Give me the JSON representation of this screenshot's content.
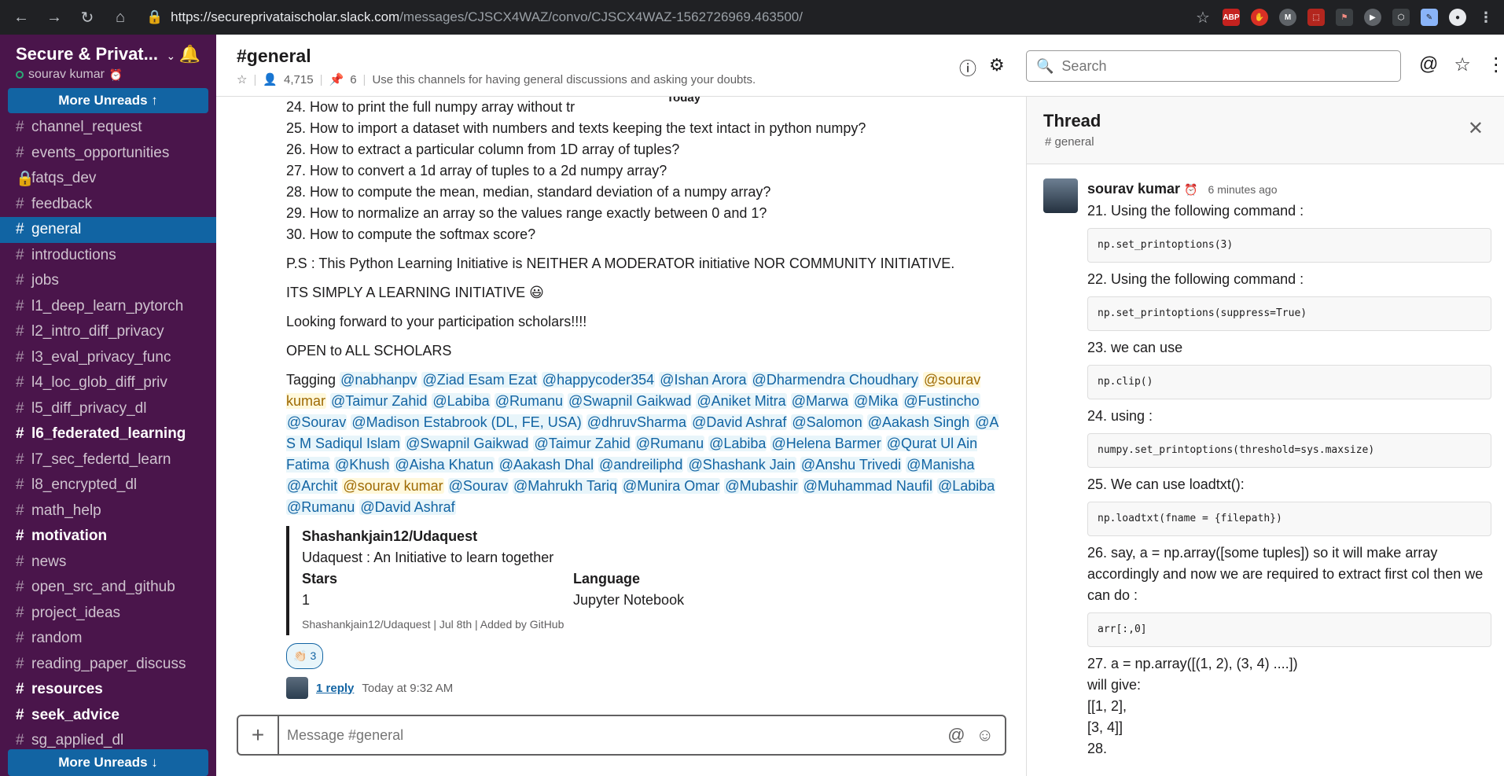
{
  "browser": {
    "url_host": "https://secureprivataischolar.slack.com",
    "url_path": "/messages/CJSCX4WAZ/convo/CJSCX4WAZ-1562726969.463500/",
    "extensions": [
      "ABP",
      "M"
    ]
  },
  "sidebar": {
    "workspace": "Secure & Privat...",
    "user": "sourav kumar",
    "more_unreads_top": "More Unreads ↑",
    "more_unreads_bottom": "More Unreads ↓",
    "channels": [
      {
        "name": "channel_request",
        "state": "normal",
        "icon": "#"
      },
      {
        "name": "events_opportunities",
        "state": "normal",
        "icon": "#"
      },
      {
        "name": "fatqs_dev",
        "state": "normal",
        "icon": "🔒"
      },
      {
        "name": "feedback",
        "state": "normal",
        "icon": "#"
      },
      {
        "name": "general",
        "state": "active",
        "icon": "#"
      },
      {
        "name": "introductions",
        "state": "normal",
        "icon": "#"
      },
      {
        "name": "jobs",
        "state": "normal",
        "icon": "#"
      },
      {
        "name": "l1_deep_learn_pytorch",
        "state": "normal",
        "icon": "#"
      },
      {
        "name": "l2_intro_diff_privacy",
        "state": "normal",
        "icon": "#"
      },
      {
        "name": "l3_eval_privacy_func",
        "state": "normal",
        "icon": "#"
      },
      {
        "name": "l4_loc_glob_diff_priv",
        "state": "normal",
        "icon": "#"
      },
      {
        "name": "l5_diff_privacy_dl",
        "state": "normal",
        "icon": "#"
      },
      {
        "name": "l6_federated_learning",
        "state": "bold",
        "icon": "#"
      },
      {
        "name": "l7_sec_federtd_learn",
        "state": "normal",
        "icon": "#"
      },
      {
        "name": "l8_encrypted_dl",
        "state": "normal",
        "icon": "#"
      },
      {
        "name": "math_help",
        "state": "normal",
        "icon": "#"
      },
      {
        "name": "motivation",
        "state": "bold",
        "icon": "#"
      },
      {
        "name": "news",
        "state": "normal",
        "icon": "#"
      },
      {
        "name": "open_src_and_github",
        "state": "normal",
        "icon": "#"
      },
      {
        "name": "project_ideas",
        "state": "normal",
        "icon": "#"
      },
      {
        "name": "random",
        "state": "normal",
        "icon": "#"
      },
      {
        "name": "reading_paper_discuss",
        "state": "normal",
        "icon": "#"
      },
      {
        "name": "resources",
        "state": "bold",
        "icon": "#"
      },
      {
        "name": "seek_advice",
        "state": "bold",
        "icon": "#"
      },
      {
        "name": "sg_applied_dl",
        "state": "normal",
        "icon": "#"
      }
    ]
  },
  "header": {
    "title": "#general",
    "members": "4,715",
    "pins": "6",
    "topic": "Use this channels for having general discussions and asking your doubts.",
    "search_placeholder": "Search"
  },
  "message": {
    "today_label": "Today",
    "questions": [
      "24. How to print the full numpy array without tr",
      "25. How to import a dataset with numbers and texts keeping the text intact in python numpy?",
      "26. How to extract a particular column from 1D array of tuples?",
      "27. How to convert a 1d array of tuples to a 2d numpy array?",
      "28. How to compute the mean, median, standard deviation of a numpy array?",
      "29. How to normalize an array so the values range exactly between 0 and 1?",
      "30. How to compute the softmax score?"
    ],
    "ps": "P.S : This Python Learning Initiative is NEITHER A MODERATOR initiative NOR COMMUNITY INITIATIVE.",
    "simply": "ITS SIMPLY A LEARNING INITIATIVE 😃",
    "forward": "Looking forward to your participation scholars!!!!",
    "open": "OPEN to ALL SCHOLARS",
    "tagging_label": "Tagging",
    "mentions": [
      {
        "name": "@nabhanpv",
        "self": false
      },
      {
        "name": "@Ziad Esam Ezat",
        "self": false
      },
      {
        "name": "@happycoder354",
        "self": false
      },
      {
        "name": "@Ishan Arora",
        "self": false
      },
      {
        "name": "@Dharmendra Choudhary",
        "self": false
      },
      {
        "name": "@sourav kumar",
        "self": true
      },
      {
        "name": "@Taimur Zahid",
        "self": false
      },
      {
        "name": "@Labiba",
        "self": false
      },
      {
        "name": "@Rumanu",
        "self": false
      },
      {
        "name": "@Swapnil Gaikwad",
        "self": false
      },
      {
        "name": "@Aniket Mitra",
        "self": false
      },
      {
        "name": "@Marwa",
        "self": false
      },
      {
        "name": "@Mika",
        "self": false
      },
      {
        "name": "@Fustincho",
        "self": false
      },
      {
        "name": "@Sourav",
        "self": false
      },
      {
        "name": "@Madison Estabrook (DL, FE, USA)",
        "self": false
      },
      {
        "name": "@dhruvSharma",
        "self": false
      },
      {
        "name": "@David Ashraf",
        "self": false
      },
      {
        "name": "@Salomon",
        "self": false
      },
      {
        "name": "@Aakash Singh",
        "self": false
      },
      {
        "name": "@A S M Sadiqul Islam",
        "self": false
      },
      {
        "name": "@Swapnil Gaikwad",
        "self": false
      },
      {
        "name": "@Taimur Zahid",
        "self": false
      },
      {
        "name": "@Rumanu",
        "self": false
      },
      {
        "name": "@Labiba",
        "self": false
      },
      {
        "name": "@Helena Barmer",
        "self": false
      },
      {
        "name": "@Qurat Ul Ain Fatima",
        "self": false
      },
      {
        "name": "@Khush",
        "self": false
      },
      {
        "name": "@Aisha Khatun",
        "self": false
      },
      {
        "name": "@Aakash Dhal",
        "self": false
      },
      {
        "name": "@andreiliphd",
        "self": false
      },
      {
        "name": "@Shashank Jain",
        "self": false
      },
      {
        "name": "@Anshu Trivedi",
        "self": false
      },
      {
        "name": "@Manisha",
        "self": false
      },
      {
        "name": "@Archit",
        "self": false
      },
      {
        "name": "@sourav kumar",
        "self": true
      },
      {
        "name": "@Sourav",
        "self": false
      },
      {
        "name": "@Mahrukh Tariq",
        "self": false
      },
      {
        "name": "@Munira Omar",
        "self": false
      },
      {
        "name": "@Mubashir",
        "self": false
      },
      {
        "name": "@Muhammad Naufil",
        "self": false
      },
      {
        "name": "@Labiba",
        "self": false
      },
      {
        "name": "@Rumanu",
        "self": false
      },
      {
        "name": "@David Ashraf",
        "self": false
      }
    ],
    "attachment": {
      "title": "Shashankjain12/Udaquest",
      "desc": "Udaquest : An Initiative to learn together",
      "field1_label": "Stars",
      "field1_value": "1",
      "field2_label": "Language",
      "field2_value": "Jupyter Notebook",
      "footer": "Shashankjain12/Udaquest | Jul 8th | Added by GitHub"
    },
    "reaction_emoji": "👏🏻",
    "reaction_count": "3",
    "reply_link": "1 reply",
    "reply_time": "Today at 9:32 AM"
  },
  "composer": {
    "placeholder": "Message #general"
  },
  "thread": {
    "title": "Thread",
    "channel": "# general",
    "author": "sourav kumar",
    "time": "6 minutes ago",
    "blocks": [
      {
        "type": "text",
        "value": "21. Using the following command :"
      },
      {
        "type": "code",
        "value": "np.set_printoptions(3)"
      },
      {
        "type": "text",
        "value": "22. Using the following command :"
      },
      {
        "type": "code",
        "value": "np.set_printoptions(suppress=True)"
      },
      {
        "type": "text",
        "value": "23. we can use"
      },
      {
        "type": "code",
        "value": "np.clip()"
      },
      {
        "type": "text",
        "value": "24. using :"
      },
      {
        "type": "code",
        "value": "numpy.set_printoptions(threshold=sys.maxsize)"
      },
      {
        "type": "text",
        "value": "25. We can use loadtxt():"
      },
      {
        "type": "code",
        "value": "np.loadtxt(fname = {filepath})"
      },
      {
        "type": "text",
        "value": "26. say, a = np.array([some tuples]) so it will make array accordingly and now we are required to extract first col then we can do :"
      },
      {
        "type": "code",
        "value": "arr[:,0]"
      },
      {
        "type": "text",
        "value": "27. a = np.array([(1, 2), (3, 4) ....])"
      },
      {
        "type": "text",
        "value": "will give:"
      },
      {
        "type": "text",
        "value": "[[1, 2],"
      },
      {
        "type": "text",
        "value": "[3, 4]]"
      },
      {
        "type": "text",
        "value": "28."
      }
    ]
  }
}
